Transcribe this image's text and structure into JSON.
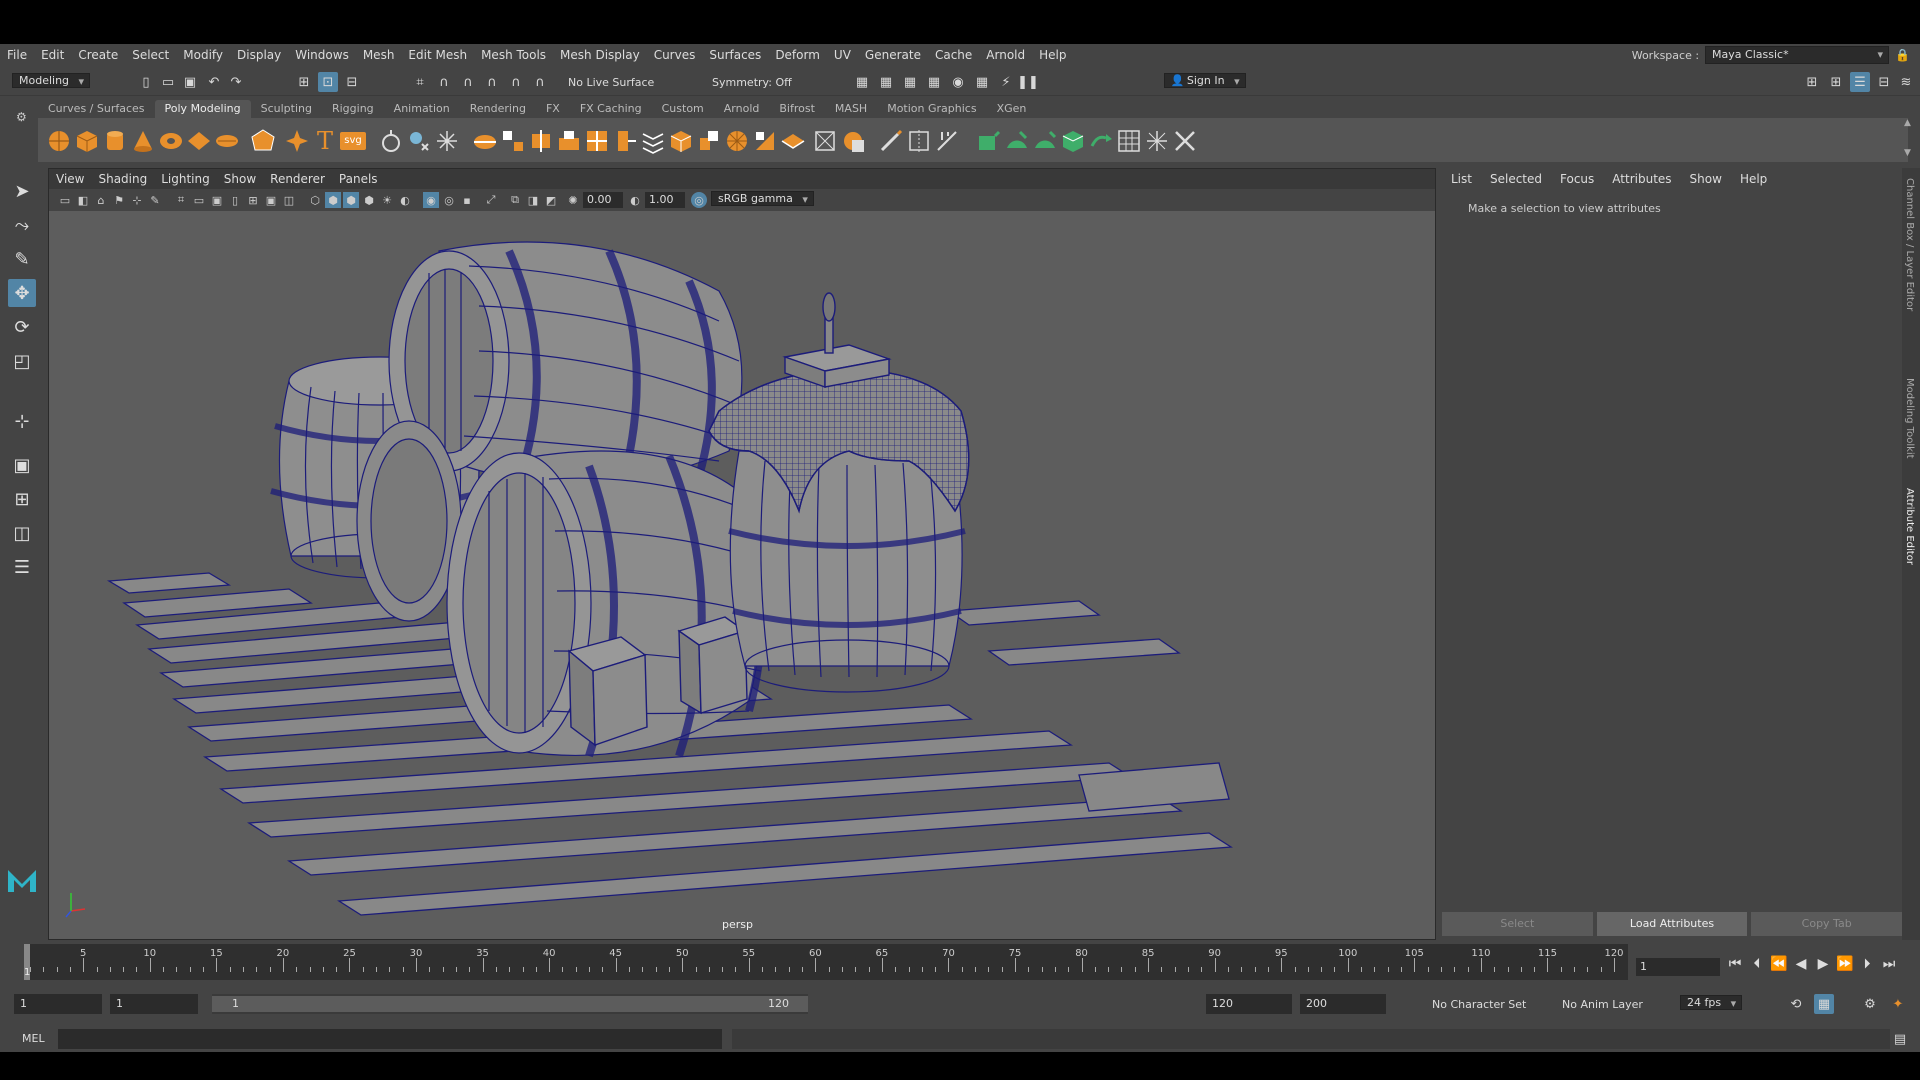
{
  "menubar": {
    "items": [
      "File",
      "Edit",
      "Create",
      "Select",
      "Modify",
      "Display",
      "Windows",
      "Mesh",
      "Edit Mesh",
      "Mesh Tools",
      "Mesh Display",
      "Curves",
      "Surfaces",
      "Deform",
      "UV",
      "Generate",
      "Cache",
      "Arnold",
      "Help"
    ],
    "workspace_label": "Workspace :",
    "workspace_value": "Maya Classic*"
  },
  "statusline": {
    "menuset": "Modeling",
    "live_surface": "No Live Surface",
    "symmetry": "Symmetry: Off",
    "sign_in": "Sign In"
  },
  "shelf": {
    "tabs": [
      "Curves / Surfaces",
      "Poly Modeling",
      "Sculpting",
      "Rigging",
      "Animation",
      "Rendering",
      "FX",
      "FX Caching",
      "Custom",
      "Arnold",
      "Bifrost",
      "MASH",
      "Motion Graphics",
      "XGen"
    ],
    "active_tab": "Poly Modeling",
    "text_icon": "T",
    "svg_icon": "svg"
  },
  "viewport": {
    "menus": [
      "View",
      "Shading",
      "Lighting",
      "Show",
      "Renderer",
      "Panels"
    ],
    "exposure": "0.00",
    "gamma": "1.00",
    "color_space": "sRGB gamma",
    "camera": "persp",
    "colors": {
      "background": "#5d5d5d",
      "wireframe": "#1c1c7a",
      "surface": "#8a8a8a"
    }
  },
  "attribute_editor": {
    "tabs": [
      "List",
      "Selected",
      "Focus",
      "Attributes",
      "Show",
      "Help"
    ],
    "message": "Make a selection to view attributes",
    "buttons": [
      "Select",
      "Load Attributes",
      "Copy Tab"
    ]
  },
  "side_tabs": [
    "Channel Box / Layer Editor",
    "Modeling Toolkit",
    "Attribute Editor"
  ],
  "timeslider": {
    "ticks": [
      "5",
      "10",
      "15",
      "20",
      "25",
      "30",
      "35",
      "40",
      "45",
      "50",
      "55",
      "60",
      "65",
      "70",
      "75",
      "80",
      "85",
      "90",
      "95",
      "100",
      "105",
      "110",
      "115",
      "120"
    ],
    "start_label": "1",
    "current_frame": "1"
  },
  "range": {
    "start": "1",
    "playback_start": "1",
    "range_start": "1",
    "range_end": "120",
    "playback_end": "120",
    "end": "200",
    "character_set": "No Character Set",
    "anim_layer": "No Anim Layer",
    "fps": "24 fps"
  },
  "command": {
    "language": "MEL"
  },
  "icons": {
    "logo": "maya-logo-icon",
    "accent": "#5285a6",
    "shelf_orange": "#e8902c",
    "shelf_green": "#3fae6a"
  }
}
